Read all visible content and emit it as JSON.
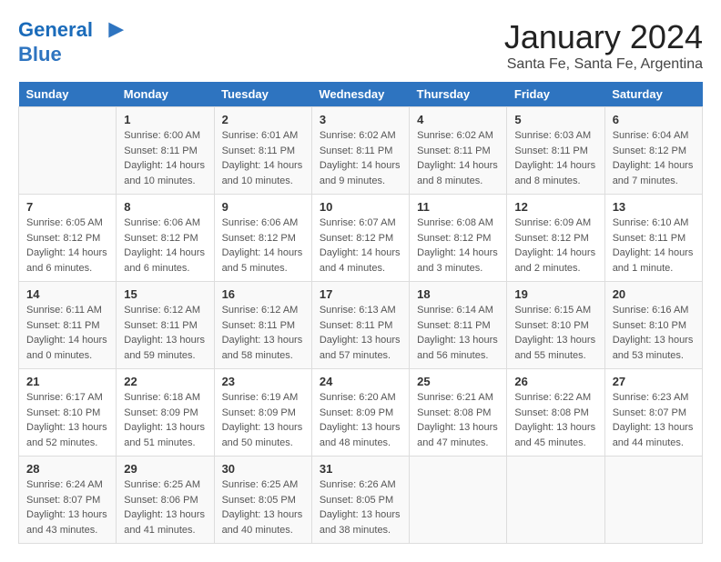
{
  "header": {
    "logo_line1": "General",
    "logo_line2": "Blue",
    "month": "January 2024",
    "location": "Santa Fe, Santa Fe, Argentina"
  },
  "weekdays": [
    "Sunday",
    "Monday",
    "Tuesday",
    "Wednesday",
    "Thursday",
    "Friday",
    "Saturday"
  ],
  "weeks": [
    [
      {
        "day": "",
        "info": ""
      },
      {
        "day": "1",
        "info": "Sunrise: 6:00 AM\nSunset: 8:11 PM\nDaylight: 14 hours\nand 10 minutes."
      },
      {
        "day": "2",
        "info": "Sunrise: 6:01 AM\nSunset: 8:11 PM\nDaylight: 14 hours\nand 10 minutes."
      },
      {
        "day": "3",
        "info": "Sunrise: 6:02 AM\nSunset: 8:11 PM\nDaylight: 14 hours\nand 9 minutes."
      },
      {
        "day": "4",
        "info": "Sunrise: 6:02 AM\nSunset: 8:11 PM\nDaylight: 14 hours\nand 8 minutes."
      },
      {
        "day": "5",
        "info": "Sunrise: 6:03 AM\nSunset: 8:11 PM\nDaylight: 14 hours\nand 8 minutes."
      },
      {
        "day": "6",
        "info": "Sunrise: 6:04 AM\nSunset: 8:12 PM\nDaylight: 14 hours\nand 7 minutes."
      }
    ],
    [
      {
        "day": "7",
        "info": "Sunrise: 6:05 AM\nSunset: 8:12 PM\nDaylight: 14 hours\nand 6 minutes."
      },
      {
        "day": "8",
        "info": "Sunrise: 6:06 AM\nSunset: 8:12 PM\nDaylight: 14 hours\nand 6 minutes."
      },
      {
        "day": "9",
        "info": "Sunrise: 6:06 AM\nSunset: 8:12 PM\nDaylight: 14 hours\nand 5 minutes."
      },
      {
        "day": "10",
        "info": "Sunrise: 6:07 AM\nSunset: 8:12 PM\nDaylight: 14 hours\nand 4 minutes."
      },
      {
        "day": "11",
        "info": "Sunrise: 6:08 AM\nSunset: 8:12 PM\nDaylight: 14 hours\nand 3 minutes."
      },
      {
        "day": "12",
        "info": "Sunrise: 6:09 AM\nSunset: 8:12 PM\nDaylight: 14 hours\nand 2 minutes."
      },
      {
        "day": "13",
        "info": "Sunrise: 6:10 AM\nSunset: 8:11 PM\nDaylight: 14 hours\nand 1 minute."
      }
    ],
    [
      {
        "day": "14",
        "info": "Sunrise: 6:11 AM\nSunset: 8:11 PM\nDaylight: 14 hours\nand 0 minutes."
      },
      {
        "day": "15",
        "info": "Sunrise: 6:12 AM\nSunset: 8:11 PM\nDaylight: 13 hours\nand 59 minutes."
      },
      {
        "day": "16",
        "info": "Sunrise: 6:12 AM\nSunset: 8:11 PM\nDaylight: 13 hours\nand 58 minutes."
      },
      {
        "day": "17",
        "info": "Sunrise: 6:13 AM\nSunset: 8:11 PM\nDaylight: 13 hours\nand 57 minutes."
      },
      {
        "day": "18",
        "info": "Sunrise: 6:14 AM\nSunset: 8:11 PM\nDaylight: 13 hours\nand 56 minutes."
      },
      {
        "day": "19",
        "info": "Sunrise: 6:15 AM\nSunset: 8:10 PM\nDaylight: 13 hours\nand 55 minutes."
      },
      {
        "day": "20",
        "info": "Sunrise: 6:16 AM\nSunset: 8:10 PM\nDaylight: 13 hours\nand 53 minutes."
      }
    ],
    [
      {
        "day": "21",
        "info": "Sunrise: 6:17 AM\nSunset: 8:10 PM\nDaylight: 13 hours\nand 52 minutes."
      },
      {
        "day": "22",
        "info": "Sunrise: 6:18 AM\nSunset: 8:09 PM\nDaylight: 13 hours\nand 51 minutes."
      },
      {
        "day": "23",
        "info": "Sunrise: 6:19 AM\nSunset: 8:09 PM\nDaylight: 13 hours\nand 50 minutes."
      },
      {
        "day": "24",
        "info": "Sunrise: 6:20 AM\nSunset: 8:09 PM\nDaylight: 13 hours\nand 48 minutes."
      },
      {
        "day": "25",
        "info": "Sunrise: 6:21 AM\nSunset: 8:08 PM\nDaylight: 13 hours\nand 47 minutes."
      },
      {
        "day": "26",
        "info": "Sunrise: 6:22 AM\nSunset: 8:08 PM\nDaylight: 13 hours\nand 45 minutes."
      },
      {
        "day": "27",
        "info": "Sunrise: 6:23 AM\nSunset: 8:07 PM\nDaylight: 13 hours\nand 44 minutes."
      }
    ],
    [
      {
        "day": "28",
        "info": "Sunrise: 6:24 AM\nSunset: 8:07 PM\nDaylight: 13 hours\nand 43 minutes."
      },
      {
        "day": "29",
        "info": "Sunrise: 6:25 AM\nSunset: 8:06 PM\nDaylight: 13 hours\nand 41 minutes."
      },
      {
        "day": "30",
        "info": "Sunrise: 6:25 AM\nSunset: 8:05 PM\nDaylight: 13 hours\nand 40 minutes."
      },
      {
        "day": "31",
        "info": "Sunrise: 6:26 AM\nSunset: 8:05 PM\nDaylight: 13 hours\nand 38 minutes."
      },
      {
        "day": "",
        "info": ""
      },
      {
        "day": "",
        "info": ""
      },
      {
        "day": "",
        "info": ""
      }
    ]
  ]
}
